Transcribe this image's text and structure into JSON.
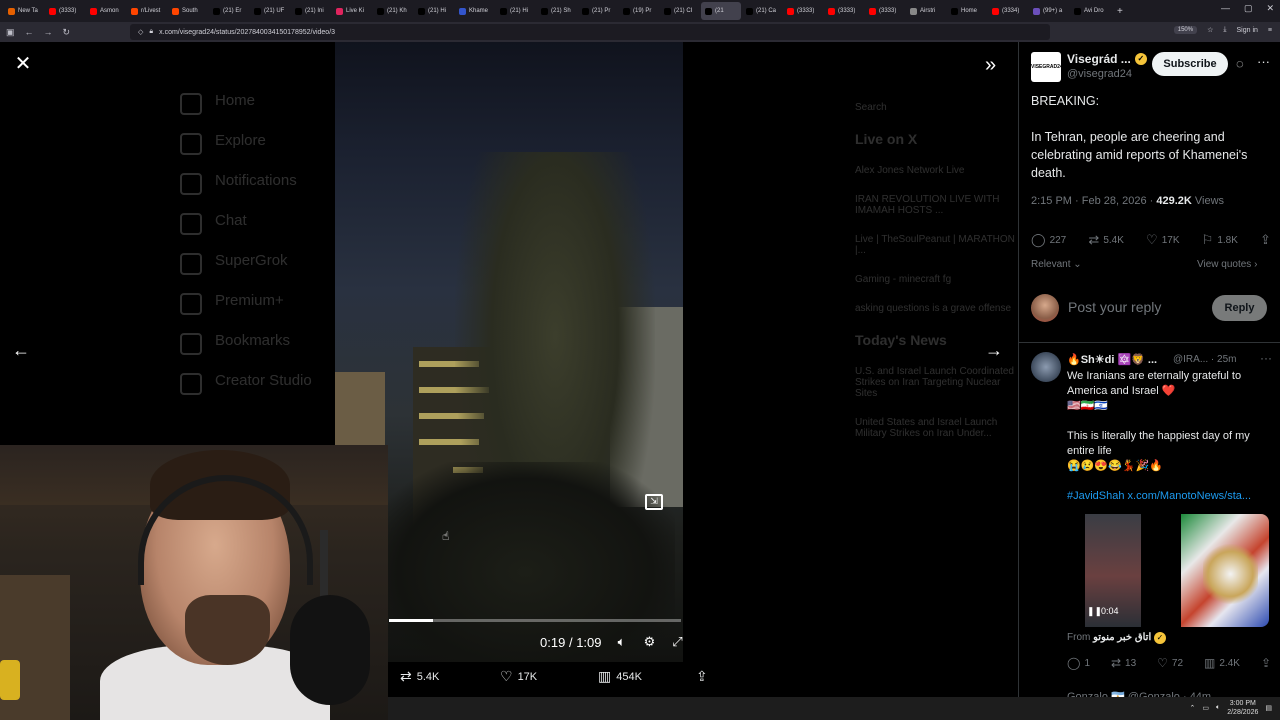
{
  "browser": {
    "tabs": [
      {
        "label": "New Ta",
        "icon": "firefox-icon",
        "color": "#e66000"
      },
      {
        "label": "(3333)",
        "icon": "youtube-icon",
        "color": "#ff0000"
      },
      {
        "label": "Asmon",
        "icon": "youtube-icon",
        "color": "#ff0000"
      },
      {
        "label": "r/Livest",
        "icon": "reddit-icon",
        "color": "#ff4500"
      },
      {
        "label": "South",
        "icon": "reddit-icon",
        "color": "#ff4500"
      },
      {
        "label": "(21) Er",
        "icon": "x-icon",
        "color": "#000000"
      },
      {
        "label": "(21) UF",
        "icon": "x-icon",
        "color": "#000000"
      },
      {
        "label": "(21) Ini",
        "icon": "x-icon",
        "color": "#000000"
      },
      {
        "label": "Live Ki",
        "icon": "live-icon",
        "color": "#e0245e"
      },
      {
        "label": "(21) Kh",
        "icon": "x-icon",
        "color": "#000000"
      },
      {
        "label": "(21) Hi",
        "icon": "x-icon",
        "color": "#000000"
      },
      {
        "label": "Khame",
        "icon": "news-icon",
        "color": "#3355cc"
      },
      {
        "label": "(21) Hi",
        "icon": "x-icon",
        "color": "#000000"
      },
      {
        "label": "(21) Sh",
        "icon": "x-icon",
        "color": "#000000"
      },
      {
        "label": "(21) Pr",
        "icon": "x-icon",
        "color": "#000000"
      },
      {
        "label": "(19) Pr",
        "icon": "x-icon",
        "color": "#000000"
      },
      {
        "label": "(21) CI",
        "icon": "x-icon",
        "color": "#000000"
      },
      {
        "label": "(21",
        "icon": "x-icon",
        "color": "#000000"
      },
      {
        "label": "(21) Ca",
        "icon": "x-icon",
        "color": "#000000"
      },
      {
        "label": "(3333)",
        "icon": "youtube-icon",
        "color": "#ff0000"
      },
      {
        "label": "(3333)",
        "icon": "youtube-icon",
        "color": "#ff0000"
      },
      {
        "label": "(3333)",
        "icon": "youtube-icon",
        "color": "#ff0000"
      },
      {
        "label": "Airstri",
        "icon": "news-icon",
        "color": "#888888"
      },
      {
        "label": "Home",
        "icon": "x-icon",
        "color": "#000000"
      },
      {
        "label": "(3334)",
        "icon": "youtube-icon",
        "color": "#ff0000"
      },
      {
        "label": "(99+) a",
        "icon": "mail-icon",
        "color": "#6b4fbb"
      },
      {
        "label": "Avi Dro",
        "icon": "x-icon",
        "color": "#000000"
      }
    ],
    "active_tab_index": 17,
    "url": "x.com/visegrad24/status/2027840034150178952/video/3",
    "zoom": "150%",
    "sign_in": "Sign in"
  },
  "background_page": {
    "nav": [
      "Home",
      "Explore",
      "Notifications",
      "Chat",
      "SuperGrok",
      "Premium+",
      "Bookmarks",
      "Creator Studio"
    ],
    "right": {
      "search": "Search",
      "live_heading": "Live on X",
      "live_items": [
        "Alex Jones Network Live",
        "IRAN REVOLUTION LIVE WITH IMAMAH HOSTS ...",
        "Live | TheSoulPeanut | MARATHON |...",
        "Gaming - minecraft fg",
        "asking questions is a grave offense"
      ],
      "news_heading": "Today's News",
      "news_items": [
        "U.S. and Israel Launch Coordinated Strikes on Iran Targeting Nuclear Sites",
        "United States and Israel Launch Military Strikes on Iran Under..."
      ]
    }
  },
  "video": {
    "current_time": "0:19",
    "duration": "1:09",
    "time_separator": "/",
    "progress_fraction": 0.15,
    "reposts": "5.4K",
    "likes": "17K",
    "views": "454K"
  },
  "tweet": {
    "author_name": "Visegrád ...",
    "author_avatar_text": "VISEGRAD24",
    "author_handle": "@visegrad24",
    "subscribe_label": "Subscribe",
    "text_line1": "BREAKING:",
    "text_line2": "In Tehran, people are cheering and celebrating amid reports of Khamenei's death.",
    "timestamp": "2:15 PM · Feb 28, 2026 · ",
    "views_count": "429.2K",
    "views_label": " Views",
    "replies": "227",
    "reposts": "5.4K",
    "likes": "17K",
    "bookmarks": "1.8K",
    "sort_label": "Relevant",
    "view_quotes": "View quotes",
    "reply_placeholder": "Post your reply",
    "reply_button": "Reply"
  },
  "reply": {
    "name": "🔥Sh☀di 🔯🦁 ...",
    "handle": "@IRA...",
    "age": " · 25m",
    "line1": "We Iranians are eternally grateful to America and Israel ❤️",
    "flags": "🇺🇸🇮🇷🇮🇱",
    "line2": "This is literally the happiest day of my entire life",
    "emojis": "😭😢😍😂💃🎉🔥",
    "link": "#JavidShah x.com/ManotoNews/sta...",
    "media_time": "0:04",
    "from_label": "From ",
    "from_name": "اتاق خبر منوتو",
    "replies": "1",
    "reposts": "13",
    "likes": "72",
    "views": "2.4K",
    "next_name": "Gonzalo 🇦🇷 @Gonzalo · 44m"
  },
  "taskbar": {
    "time": "3:00 PM",
    "date": "2/28/2026"
  },
  "colors": {
    "accent": "#1d9bf0",
    "text": "#e7e9ea",
    "muted": "#71767b"
  }
}
